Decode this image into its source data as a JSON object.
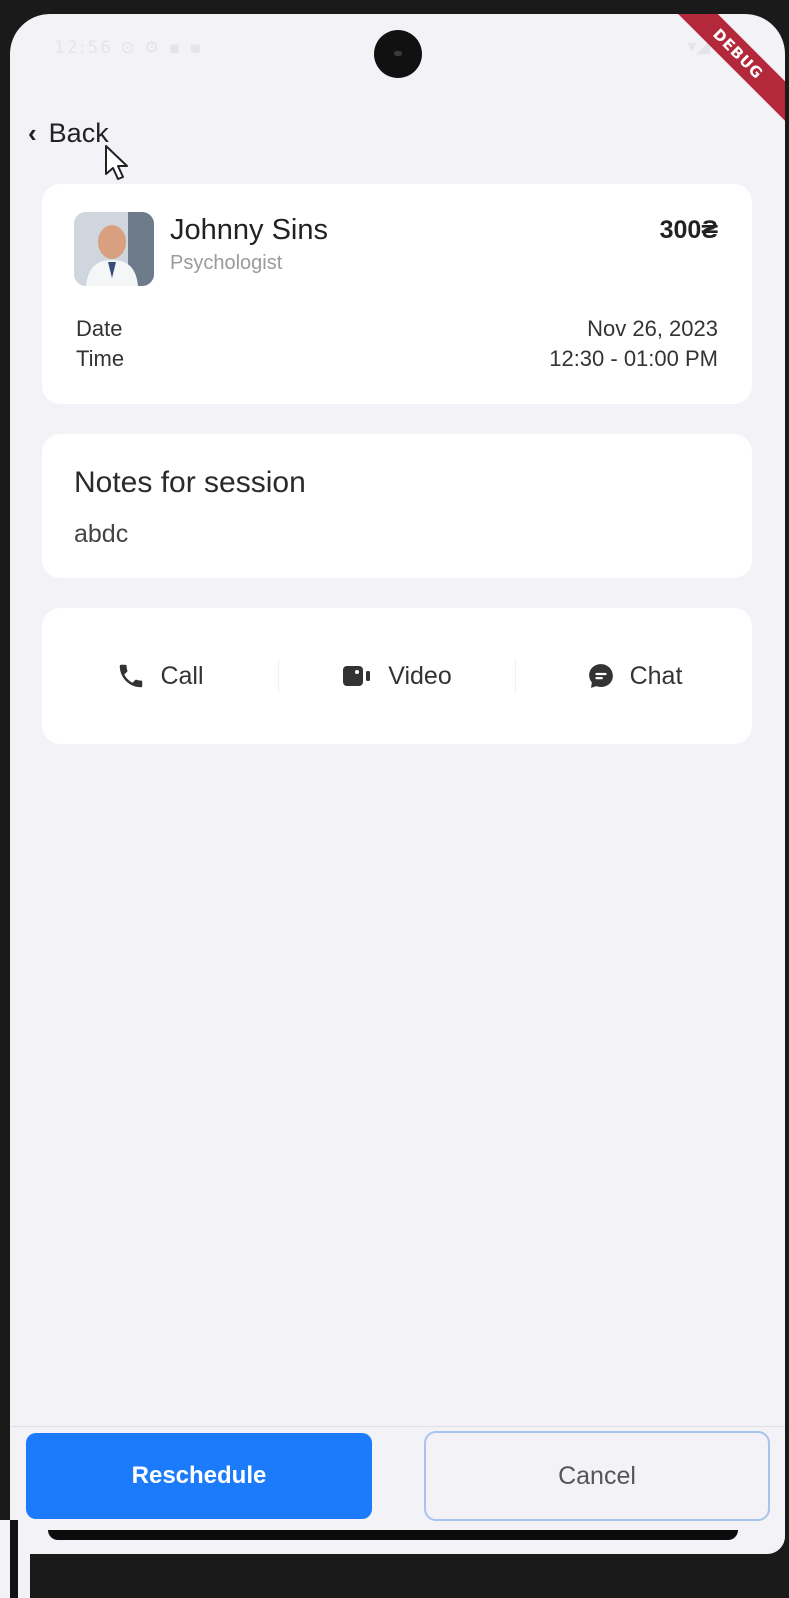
{
  "status_bar": {
    "time": "12:56",
    "left_icons": "⊙ ⚙ ▪ ▪",
    "right_icons": "▾◢ ▮"
  },
  "debug_banner": "DEBUG",
  "nav": {
    "back_label": "Back"
  },
  "doctor": {
    "name": "Johnny Sins",
    "role": "Psychologist",
    "price": "300₴",
    "date_label": "Date",
    "date_value": "Nov 26, 2023",
    "time_label": "Time",
    "time_value": "12:30 - 01:00 PM"
  },
  "notes": {
    "title": "Notes for session",
    "body": "abdc"
  },
  "actions": [
    {
      "label": "Call",
      "icon": "phone-icon"
    },
    {
      "label": "Video",
      "icon": "video-camera-icon"
    },
    {
      "label": "Chat",
      "icon": "chat-bubble-icon"
    }
  ],
  "buttons": {
    "reschedule": "Reschedule",
    "cancel": "Cancel"
  },
  "colors": {
    "accent": "#1b7bfa",
    "background": "#f2f2f7",
    "card": "#ffffff",
    "debug_ribbon": "#b3283a"
  }
}
